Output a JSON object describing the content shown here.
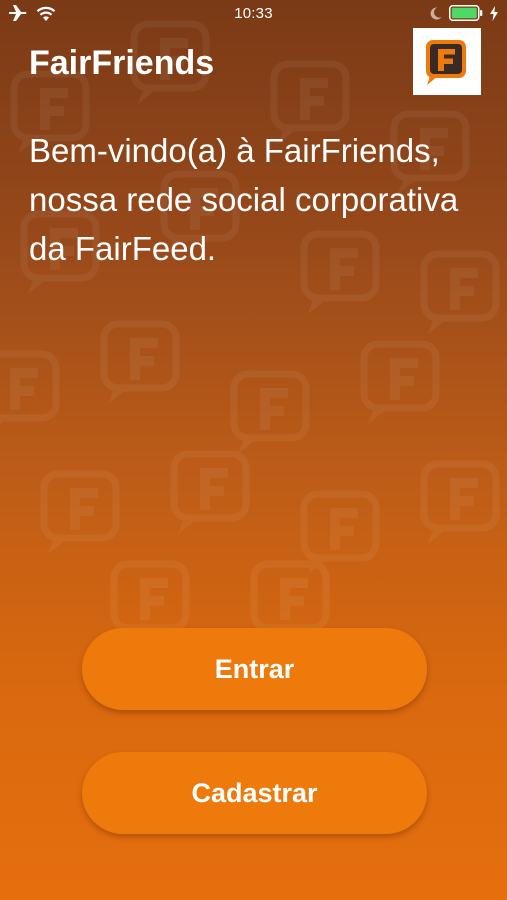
{
  "status_bar": {
    "time": "10:33",
    "icons": [
      "airplane-icon",
      "wifi-icon",
      "moon-icon",
      "battery-icon",
      "charging-bolt-icon"
    ],
    "battery_color": "#4cd964"
  },
  "header": {
    "app_title": "FairFriends",
    "logo_letter": "F"
  },
  "main": {
    "welcome_text": "Bem-vindo(a) à FairFriends, nossa rede social corporativa da FairFeed."
  },
  "actions": {
    "login_label": "Entrar",
    "signup_label": "Cadastrar"
  },
  "colors": {
    "brand_orange": "#ee7a0c",
    "logo_dark": "#3a2a24",
    "background_top": "#7a3a16",
    "background_bottom": "#e66f0d"
  }
}
